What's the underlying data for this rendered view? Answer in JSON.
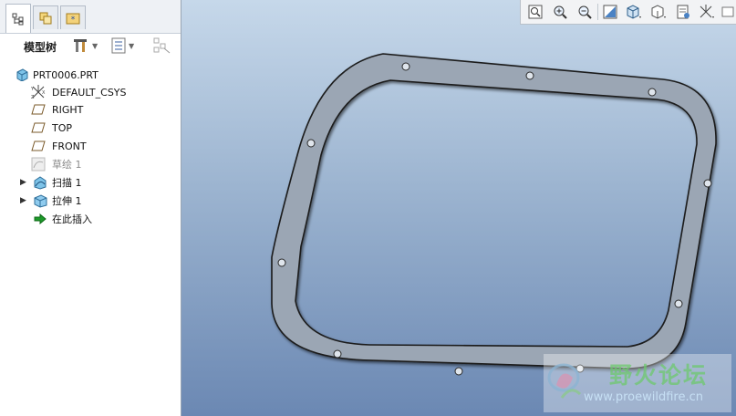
{
  "model_tree": {
    "title": "模型树",
    "items": [
      {
        "label": "PRT0006.PRT",
        "icon": "part-icon",
        "expandable": false,
        "dimmed": false
      },
      {
        "label": "DEFAULT_CSYS",
        "icon": "csys-icon",
        "expandable": false,
        "dimmed": false
      },
      {
        "label": "RIGHT",
        "icon": "datum-plane-icon",
        "expandable": false,
        "dimmed": false
      },
      {
        "label": "TOP",
        "icon": "datum-plane-icon",
        "expandable": false,
        "dimmed": false
      },
      {
        "label": "FRONT",
        "icon": "datum-plane-icon",
        "expandable": false,
        "dimmed": false
      },
      {
        "label": "草绘 1",
        "icon": "sketch-icon",
        "expandable": false,
        "dimmed": true
      },
      {
        "label": "扫描 1",
        "icon": "sweep-icon",
        "expandable": true,
        "dimmed": false
      },
      {
        "label": "拉伸 1",
        "icon": "extrude-icon",
        "expandable": true,
        "dimmed": false
      },
      {
        "label": "在此插入",
        "icon": "insert-here-icon",
        "expandable": false,
        "dimmed": false
      }
    ]
  },
  "tabs": [
    "model-tree-tab",
    "layers-tab",
    "favorites-tab"
  ],
  "view_toolbar": [
    "refit-icon",
    "zoom-in-icon",
    "zoom-out-icon",
    "repaint-icon",
    "display-style-icon",
    "saved-views-icon",
    "view-manager-icon",
    "datum-display-icon",
    "more-icon"
  ],
  "watermark": {
    "name": "野火论坛",
    "url": "www.proewildfire.cn"
  },
  "colors": {
    "viewport_top": "#c6d8ea",
    "viewport_bottom": "#6b88b3",
    "part_fill": "#9ba6b4",
    "part_edge": "#1a1a1a"
  }
}
